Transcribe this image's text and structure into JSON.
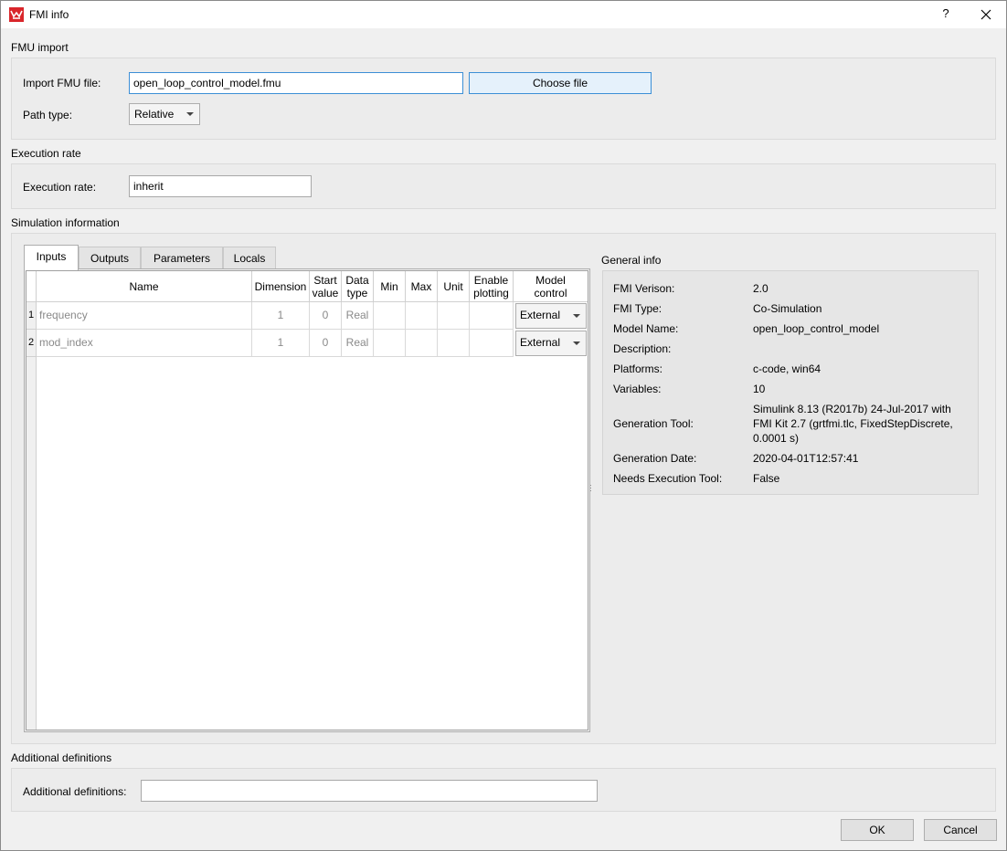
{
  "window": {
    "title": "FMI info",
    "help_label": "?",
    "close_label": "✕"
  },
  "fmu_import": {
    "section_title": "FMU import",
    "file_label": "Import FMU file:",
    "file_value": "open_loop_control_model.fmu",
    "choose_button": "Choose file",
    "path_type_label": "Path type:",
    "path_type_value": "Relative"
  },
  "execution_rate": {
    "section_title": "Execution rate",
    "label": "Execution rate:",
    "value": "inherit"
  },
  "simulation": {
    "section_title": "Simulation information",
    "tabs": [
      {
        "label": "Inputs",
        "active": true
      },
      {
        "label": "Outputs"
      },
      {
        "label": "Parameters"
      },
      {
        "label": "Locals"
      }
    ],
    "columns": {
      "name": "Name",
      "dimension": "Dimension",
      "start_value_1": "Start",
      "start_value_2": "value",
      "data_type_1": "Data",
      "data_type_2": "type",
      "min": "Min",
      "max": "Max",
      "unit": "Unit",
      "enable_plotting_1": "Enable",
      "enable_plotting_2": "plotting",
      "model_control_1": "Model",
      "model_control_2": "control"
    },
    "rows": [
      {
        "index": "1",
        "name": "frequency",
        "dimension": "1",
        "start_value": "0",
        "data_type": "Real",
        "min": "",
        "max": "",
        "unit": "",
        "enable_plotting": "",
        "model_control": "External"
      },
      {
        "index": "2",
        "name": "mod_index",
        "dimension": "1",
        "start_value": "0",
        "data_type": "Real",
        "min": "",
        "max": "",
        "unit": "",
        "enable_plotting": "",
        "model_control": "External"
      }
    ]
  },
  "general_info": {
    "title": "General info",
    "rows": [
      {
        "key": "FMI Verison:",
        "value": "2.0"
      },
      {
        "key": "FMI Type:",
        "value": "Co-Simulation"
      },
      {
        "key": "Model Name:",
        "value": "open_loop_control_model"
      },
      {
        "key": "Description:",
        "value": ""
      },
      {
        "key": "Platforms:",
        "value": "c-code, win64"
      },
      {
        "key": "Variables:",
        "value": "10"
      },
      {
        "key": "Generation Tool:",
        "value_lines": [
          "Simulink 8.13 (R2017b) 24-Jul-2017 with",
          "FMI Kit 2.7 (grtfmi.tlc, FixedStepDiscrete,",
          "0.0001 s)"
        ]
      },
      {
        "key": "Generation Date:",
        "value": "2020-04-01T12:57:41"
      },
      {
        "key": "Needs Execution Tool:",
        "value": "False"
      }
    ]
  },
  "additional": {
    "section_title": "Additional definitions",
    "label": "Additional definitions:",
    "value": ""
  },
  "footer": {
    "ok": "OK",
    "cancel": "Cancel"
  },
  "colors": {
    "accent": "#3c8fd6",
    "app_icon": "#d9262b"
  }
}
